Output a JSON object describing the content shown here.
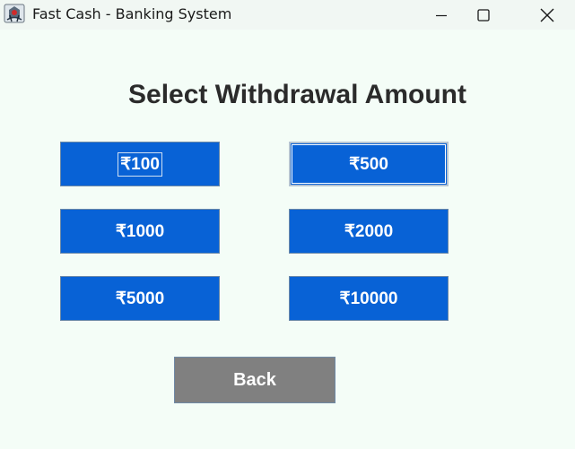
{
  "window": {
    "title": "Fast Cash - Banking System",
    "app_icon": "java-cup-icon",
    "controls": {
      "minimize_icon": "minimize-icon",
      "maximize_icon": "maximize-icon",
      "close_icon": "close-icon"
    }
  },
  "main": {
    "heading": "Select Withdrawal Amount",
    "amounts": [
      {
        "label": "₹100"
      },
      {
        "label": "₹500"
      },
      {
        "label": "₹1000"
      },
      {
        "label": "₹2000"
      },
      {
        "label": "₹5000"
      },
      {
        "label": "₹10000"
      }
    ],
    "back_label": "Back"
  },
  "colors": {
    "background": "#f4fdf7",
    "amount_button": "#0862d6",
    "back_button": "#808080",
    "heading_text": "#2b2b2b"
  }
}
